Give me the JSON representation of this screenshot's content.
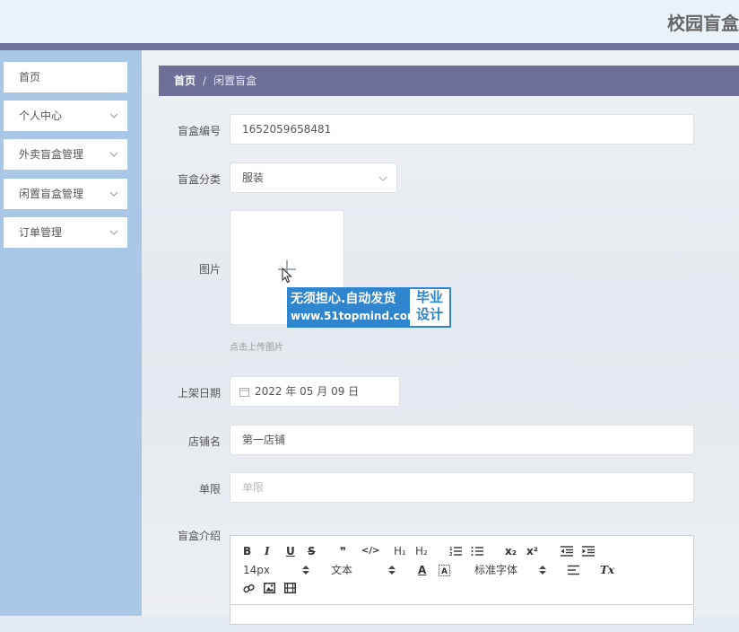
{
  "header": {
    "title": "校园盲盒"
  },
  "sidebar": {
    "items": [
      {
        "label": "首页"
      },
      {
        "label": "个人中心"
      },
      {
        "label": "外卖盲盒管理"
      },
      {
        "label": "闲置盲盒管理"
      },
      {
        "label": "订单管理"
      }
    ]
  },
  "breadcrumb": {
    "home": "首页",
    "separator": "/",
    "current": "闲置盲盒"
  },
  "form": {
    "code_label": "盲盒编号",
    "code_value": "1652059658481",
    "category_label": "盲盒分类",
    "category_value": "服装",
    "image_label": "图片",
    "image_hint": "点击上传图片",
    "date_label": "上架日期",
    "date_value": "2022 年 05 月 09 日",
    "shop_label": "店铺名",
    "shop_value": "第一店铺",
    "limit_label": "单限",
    "limit_placeholder": "单限",
    "intro_label": "盲盒介绍"
  },
  "watermark": {
    "line1": "无须担心.自动发货",
    "line2": "www.51topmind.com",
    "badge1": "毕业",
    "badge2": "设计"
  },
  "editor": {
    "toolbar": {
      "bold": "B",
      "italic": "I",
      "underline": "U",
      "strike": "S",
      "quote": "❞",
      "code": "</>",
      "h1": "H₁",
      "h2": "H₂",
      "subscript": "x₂",
      "superscript": "x²",
      "size": "14px",
      "header_select": "文本",
      "color": "A",
      "font_select": "标准字体",
      "clean": "Tx"
    }
  }
}
